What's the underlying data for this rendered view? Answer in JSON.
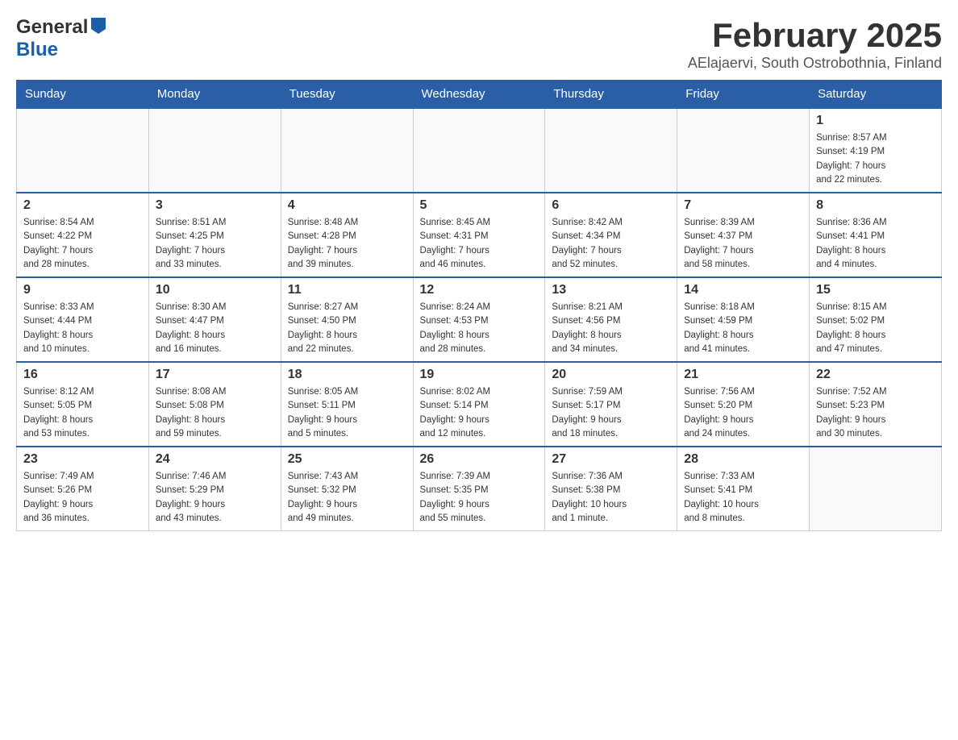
{
  "header": {
    "month_title": "February 2025",
    "subtitle": "AElajaervi, South Ostrobothnia, Finland"
  },
  "days_of_week": [
    "Sunday",
    "Monday",
    "Tuesday",
    "Wednesday",
    "Thursday",
    "Friday",
    "Saturday"
  ],
  "weeks": [
    [
      {
        "day": "",
        "info": ""
      },
      {
        "day": "",
        "info": ""
      },
      {
        "day": "",
        "info": ""
      },
      {
        "day": "",
        "info": ""
      },
      {
        "day": "",
        "info": ""
      },
      {
        "day": "",
        "info": ""
      },
      {
        "day": "1",
        "info": "Sunrise: 8:57 AM\nSunset: 4:19 PM\nDaylight: 7 hours\nand 22 minutes."
      }
    ],
    [
      {
        "day": "2",
        "info": "Sunrise: 8:54 AM\nSunset: 4:22 PM\nDaylight: 7 hours\nand 28 minutes."
      },
      {
        "day": "3",
        "info": "Sunrise: 8:51 AM\nSunset: 4:25 PM\nDaylight: 7 hours\nand 33 minutes."
      },
      {
        "day": "4",
        "info": "Sunrise: 8:48 AM\nSunset: 4:28 PM\nDaylight: 7 hours\nand 39 minutes."
      },
      {
        "day": "5",
        "info": "Sunrise: 8:45 AM\nSunset: 4:31 PM\nDaylight: 7 hours\nand 46 minutes."
      },
      {
        "day": "6",
        "info": "Sunrise: 8:42 AM\nSunset: 4:34 PM\nDaylight: 7 hours\nand 52 minutes."
      },
      {
        "day": "7",
        "info": "Sunrise: 8:39 AM\nSunset: 4:37 PM\nDaylight: 7 hours\nand 58 minutes."
      },
      {
        "day": "8",
        "info": "Sunrise: 8:36 AM\nSunset: 4:41 PM\nDaylight: 8 hours\nand 4 minutes."
      }
    ],
    [
      {
        "day": "9",
        "info": "Sunrise: 8:33 AM\nSunset: 4:44 PM\nDaylight: 8 hours\nand 10 minutes."
      },
      {
        "day": "10",
        "info": "Sunrise: 8:30 AM\nSunset: 4:47 PM\nDaylight: 8 hours\nand 16 minutes."
      },
      {
        "day": "11",
        "info": "Sunrise: 8:27 AM\nSunset: 4:50 PM\nDaylight: 8 hours\nand 22 minutes."
      },
      {
        "day": "12",
        "info": "Sunrise: 8:24 AM\nSunset: 4:53 PM\nDaylight: 8 hours\nand 28 minutes."
      },
      {
        "day": "13",
        "info": "Sunrise: 8:21 AM\nSunset: 4:56 PM\nDaylight: 8 hours\nand 34 minutes."
      },
      {
        "day": "14",
        "info": "Sunrise: 8:18 AM\nSunset: 4:59 PM\nDaylight: 8 hours\nand 41 minutes."
      },
      {
        "day": "15",
        "info": "Sunrise: 8:15 AM\nSunset: 5:02 PM\nDaylight: 8 hours\nand 47 minutes."
      }
    ],
    [
      {
        "day": "16",
        "info": "Sunrise: 8:12 AM\nSunset: 5:05 PM\nDaylight: 8 hours\nand 53 minutes."
      },
      {
        "day": "17",
        "info": "Sunrise: 8:08 AM\nSunset: 5:08 PM\nDaylight: 8 hours\nand 59 minutes."
      },
      {
        "day": "18",
        "info": "Sunrise: 8:05 AM\nSunset: 5:11 PM\nDaylight: 9 hours\nand 5 minutes."
      },
      {
        "day": "19",
        "info": "Sunrise: 8:02 AM\nSunset: 5:14 PM\nDaylight: 9 hours\nand 12 minutes."
      },
      {
        "day": "20",
        "info": "Sunrise: 7:59 AM\nSunset: 5:17 PM\nDaylight: 9 hours\nand 18 minutes."
      },
      {
        "day": "21",
        "info": "Sunrise: 7:56 AM\nSunset: 5:20 PM\nDaylight: 9 hours\nand 24 minutes."
      },
      {
        "day": "22",
        "info": "Sunrise: 7:52 AM\nSunset: 5:23 PM\nDaylight: 9 hours\nand 30 minutes."
      }
    ],
    [
      {
        "day": "23",
        "info": "Sunrise: 7:49 AM\nSunset: 5:26 PM\nDaylight: 9 hours\nand 36 minutes."
      },
      {
        "day": "24",
        "info": "Sunrise: 7:46 AM\nSunset: 5:29 PM\nDaylight: 9 hours\nand 43 minutes."
      },
      {
        "day": "25",
        "info": "Sunrise: 7:43 AM\nSunset: 5:32 PM\nDaylight: 9 hours\nand 49 minutes."
      },
      {
        "day": "26",
        "info": "Sunrise: 7:39 AM\nSunset: 5:35 PM\nDaylight: 9 hours\nand 55 minutes."
      },
      {
        "day": "27",
        "info": "Sunrise: 7:36 AM\nSunset: 5:38 PM\nDaylight: 10 hours\nand 1 minute."
      },
      {
        "day": "28",
        "info": "Sunrise: 7:33 AM\nSunset: 5:41 PM\nDaylight: 10 hours\nand 8 minutes."
      },
      {
        "day": "",
        "info": ""
      }
    ]
  ],
  "logo": {
    "general": "General",
    "blue": "Blue"
  }
}
